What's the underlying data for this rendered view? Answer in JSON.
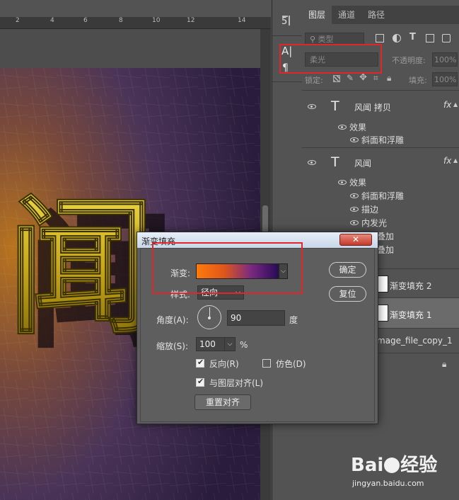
{
  "ruler": {
    "ticks": [
      "2",
      "4",
      "6",
      "8",
      "10",
      "12",
      "14"
    ]
  },
  "artwork": {
    "glyph": "闻"
  },
  "tools": {
    "top_icon": "text-warp-icon",
    "char_icon_label": "A|",
    "para_icon_label": "¶"
  },
  "layers_panel": {
    "tabs": [
      {
        "label": "图层",
        "active": true
      },
      {
        "label": "通道",
        "active": false
      },
      {
        "label": "路径",
        "active": false
      }
    ],
    "filter": {
      "label": "类型"
    },
    "blend_mode": "柔光",
    "opacity_label": "不透明度:",
    "opacity_value": "100%",
    "lock_label": "锁定:",
    "fill_label": "填充:",
    "fill_value": "100%",
    "layers": [
      {
        "name": "风闻 拷贝",
        "fx": "fx",
        "effects_label": "效果",
        "effects": [
          "斜面和浮雕"
        ]
      },
      {
        "name": "风闻",
        "fx": "fx",
        "effects_label": "效果",
        "effects": [
          "斜面和浮雕",
          "描边",
          "内发光",
          "叠加",
          "叠加"
        ]
      }
    ],
    "fill_layers": [
      {
        "name": "渐变填充 2"
      },
      {
        "name": "渐变填充 1"
      }
    ],
    "image_layer": {
      "name": "mage_file_copy_1"
    }
  },
  "dialog": {
    "title": "渐变填充",
    "gradient_label": "渐变:",
    "gradient_colors": [
      "#ff7a0a",
      "#e0571a",
      "#7a2a80",
      "#2a0a5a"
    ],
    "style_label": "样式:",
    "style_value": "径向",
    "angle_label": "角度(A):",
    "angle_value": "90",
    "angle_unit": "度",
    "scale_label": "缩放(S):",
    "scale_value": "100",
    "scale_unit": "%",
    "reverse_label": "反向(R)",
    "reverse_checked": true,
    "dither_label": "仿色(D)",
    "dither_checked": false,
    "align_label": "与图层对齐(L)",
    "align_checked": true,
    "reset_align_label": "重置对齐",
    "ok_label": "确定",
    "reset_label": "复位"
  },
  "watermark": {
    "brand": "Bai",
    "brand2": "经验",
    "url": "jingyan.baidu.com"
  },
  "colors": {
    "highlight_red": "#e0262b",
    "panel_bg": "#535353",
    "dialog_bg": "#5e5e5e"
  }
}
